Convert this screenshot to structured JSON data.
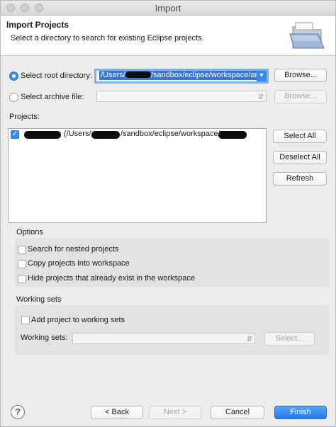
{
  "window": {
    "title": "Import"
  },
  "header": {
    "title": "Import Projects",
    "description": "Select a directory to search for existing Eclipse projects."
  },
  "source": {
    "root_dir_label": "Select root directory:",
    "root_dir_value": "/Users/",
    "root_dir_value_tail": "/sandbox/eclipse/workspace/ar",
    "root_dir_selected": true,
    "archive_label": "Select archive file:",
    "archive_value": "",
    "browse_label": "Browse...",
    "browse_archive_label": "Browse..."
  },
  "projects": {
    "label": "Projects:",
    "items": [
      {
        "path_prefix": "(/Users/",
        "path_mid": "/sandbox/eclipse/workspace/",
        "checked": true
      }
    ],
    "select_all_label": "Select All",
    "deselect_all_label": "Deselect All",
    "refresh_label": "Refresh"
  },
  "options": {
    "title": "Options",
    "nested_label": "Search for nested projects",
    "copy_label": "Copy projects into workspace",
    "hide_label": "Hide projects that already exist in the workspace"
  },
  "working_sets": {
    "title": "Working sets",
    "add_label": "Add project to working sets",
    "sets_label": "Working sets:",
    "sets_value": "",
    "select_label": "Select..."
  },
  "footer": {
    "help_glyph": "?",
    "back_label": "< Back",
    "next_label": "Next >",
    "cancel_label": "Cancel",
    "finish_label": "Finish"
  },
  "colors": {
    "accent": "#3b8dea",
    "selection": "#3b76d4",
    "group_bg": "#e2e2e2"
  }
}
